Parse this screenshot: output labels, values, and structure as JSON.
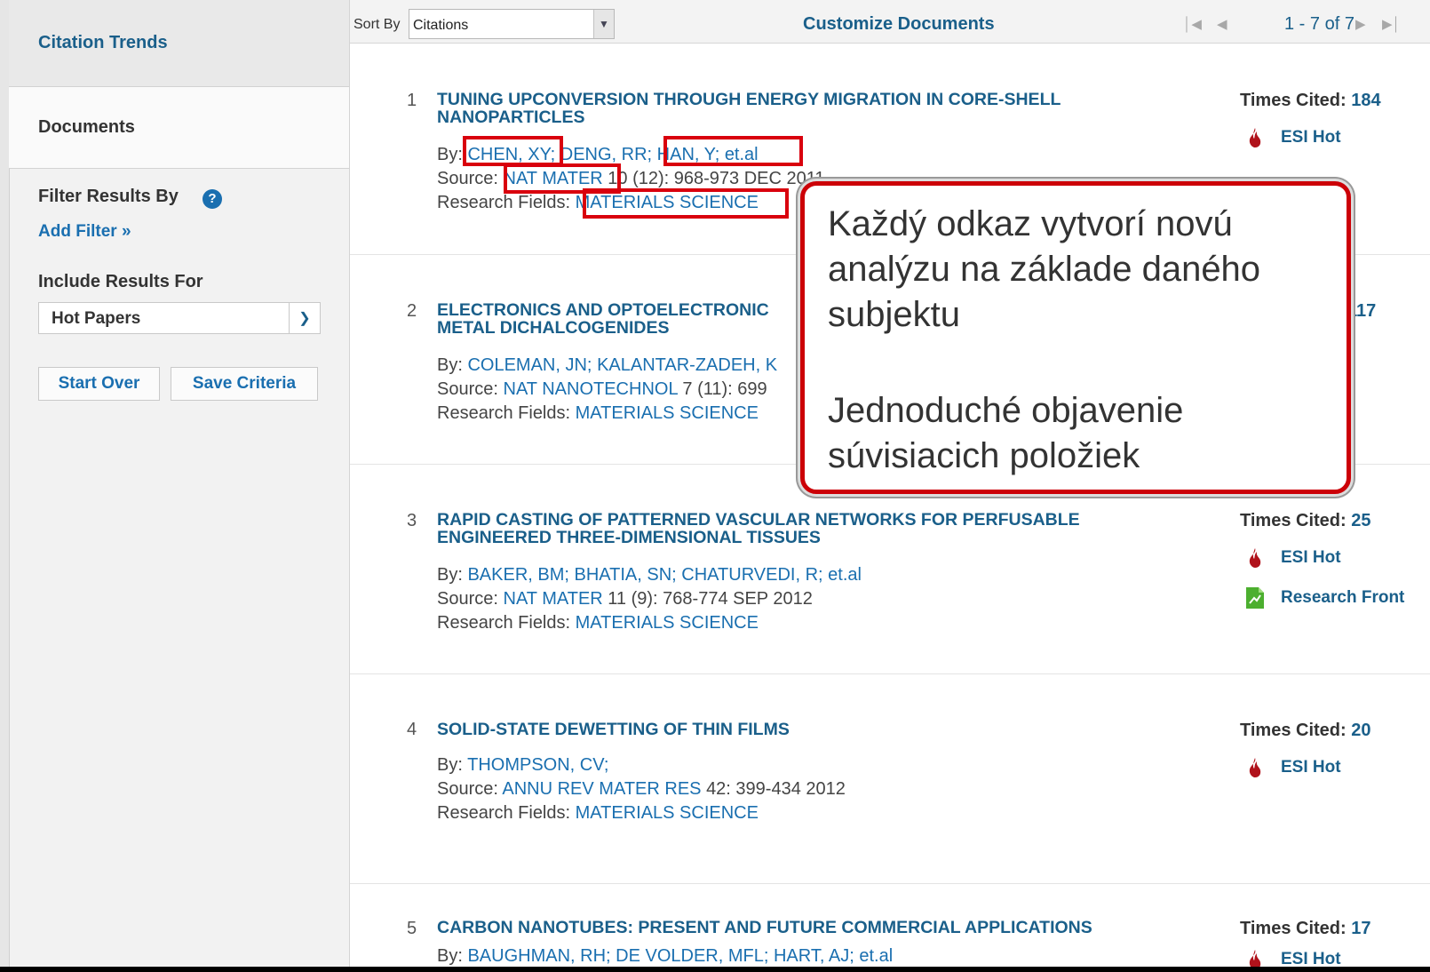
{
  "sidebar": {
    "citation_trends": "Citation Trends",
    "documents": "Documents",
    "filter_title": "Filter Results By",
    "help": "?",
    "add_filter": "Add Filter »",
    "include_title": "Include Results For",
    "include_value": "Hot Papers",
    "start_over": "Start Over",
    "save_criteria": "Save Criteria"
  },
  "toolbar": {
    "sort_label": "Sort By",
    "sort_value": "Citations",
    "customize": "Customize Documents",
    "pagination": "1 - 7 of 7"
  },
  "documents": [
    {
      "num": "1",
      "title": "TUNING UPCONVERSION THROUGH ENERGY MIGRATION IN CORE-SHELL NANOPARTICLES",
      "by_label": "By:",
      "authors": [
        "CHEN, XY;",
        "DENG, RR;",
        "HAN, Y;",
        "et.al"
      ],
      "source_label": "Source:",
      "source_journal": "NAT MATER",
      "source_rest": "10 (12): 968-973 DEC 2011",
      "fields_label": "Research Fields:",
      "fields": "MATERIALS SCIENCE",
      "cited_label": "Times Cited:",
      "cited": "184",
      "badges": [
        "ESI Hot"
      ]
    },
    {
      "num": "2",
      "title": "ELECTRONICS AND OPTOELECTRONIC",
      "title2": "METAL DICHALCOGENIDES",
      "by_label": "By:",
      "authors": [
        "COLEMAN, JN;",
        "KALANTAR-ZADEH, K"
      ],
      "source_label": "Source:",
      "source_journal": "NAT NANOTECHNOL",
      "source_rest": "7 (11): 699",
      "fields_label": "Research Fields:",
      "fields": "MATERIALS SCIENCE",
      "cited": "117"
    },
    {
      "num": "3",
      "title": "RAPID CASTING OF PATTERNED VASCULAR NETWORKS FOR PERFUSABLE ENGINEERED THREE-DIMENSIONAL TISSUES",
      "by_label": "By:",
      "authors": [
        "BAKER, BM;",
        "BHATIA, SN;",
        "CHATURVEDI, R;",
        "et.al"
      ],
      "source_label": "Source:",
      "source_journal": "NAT MATER",
      "source_rest": "11 (9): 768-774 SEP 2012",
      "fields_label": "Research Fields:",
      "fields": "MATERIALS SCIENCE",
      "cited_label": "Times Cited:",
      "cited": "25",
      "badges": [
        "ESI Hot",
        "Research Front"
      ]
    },
    {
      "num": "4",
      "title": "SOLID-STATE DEWETTING OF THIN FILMS",
      "by_label": "By:",
      "authors": [
        "THOMPSON, CV;"
      ],
      "source_label": "Source:",
      "source_journal": "ANNU REV MATER RES",
      "source_rest": "42: 399-434 2012",
      "fields_label": "Research Fields:",
      "fields": "MATERIALS SCIENCE",
      "cited_label": "Times Cited:",
      "cited": "20",
      "badges": [
        "ESI Hot"
      ]
    },
    {
      "num": "5",
      "title": "CARBON NANOTUBES: PRESENT AND FUTURE COMMERCIAL APPLICATIONS",
      "by_label": "By:",
      "authors": [
        "BAUGHMAN, RH;",
        "DE VOLDER, MFL;",
        "HART, AJ;",
        "et.al"
      ],
      "cited_label": "Times Cited:",
      "cited": "17",
      "badges": [
        "ESI Hot"
      ]
    }
  ],
  "callout": {
    "text1": "Každý odkaz vytvorí novú analýzu na základe daného subjektu",
    "text2": "Jednoduché objavenie súvisiacich položiek"
  },
  "colors": {
    "link": "#1a6fb0",
    "title": "#1a5f8a",
    "highlight": "#d9000d",
    "esi_hot_icon": "#b0121b",
    "research_front_icon": "#4caf2f"
  },
  "icons": [
    "help-icon",
    "chevron-down-icon",
    "first-page-icon",
    "prev-page-icon",
    "next-page-icon",
    "last-page-icon",
    "flame-icon",
    "research-front-icon"
  ]
}
